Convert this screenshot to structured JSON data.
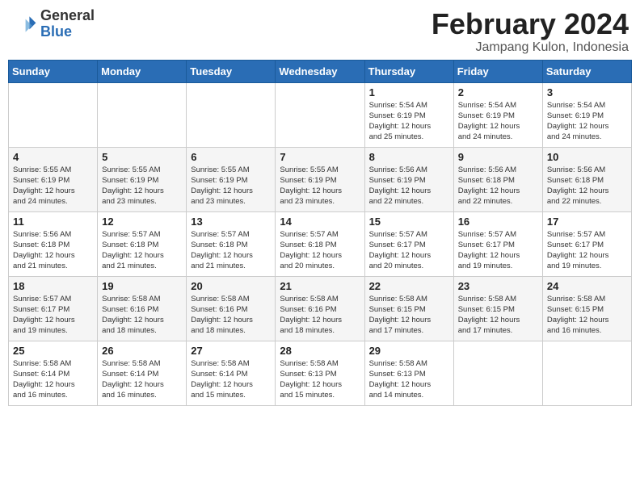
{
  "header": {
    "logo_general": "General",
    "logo_blue": "Blue",
    "month_year": "February 2024",
    "location": "Jampang Kulon, Indonesia"
  },
  "calendar": {
    "days_of_week": [
      "Sunday",
      "Monday",
      "Tuesday",
      "Wednesday",
      "Thursday",
      "Friday",
      "Saturday"
    ],
    "weeks": [
      [
        {
          "day": "",
          "info": ""
        },
        {
          "day": "",
          "info": ""
        },
        {
          "day": "",
          "info": ""
        },
        {
          "day": "",
          "info": ""
        },
        {
          "day": "1",
          "info": "Sunrise: 5:54 AM\nSunset: 6:19 PM\nDaylight: 12 hours\nand 25 minutes."
        },
        {
          "day": "2",
          "info": "Sunrise: 5:54 AM\nSunset: 6:19 PM\nDaylight: 12 hours\nand 24 minutes."
        },
        {
          "day": "3",
          "info": "Sunrise: 5:54 AM\nSunset: 6:19 PM\nDaylight: 12 hours\nand 24 minutes."
        }
      ],
      [
        {
          "day": "4",
          "info": "Sunrise: 5:55 AM\nSunset: 6:19 PM\nDaylight: 12 hours\nand 24 minutes."
        },
        {
          "day": "5",
          "info": "Sunrise: 5:55 AM\nSunset: 6:19 PM\nDaylight: 12 hours\nand 23 minutes."
        },
        {
          "day": "6",
          "info": "Sunrise: 5:55 AM\nSunset: 6:19 PM\nDaylight: 12 hours\nand 23 minutes."
        },
        {
          "day": "7",
          "info": "Sunrise: 5:55 AM\nSunset: 6:19 PM\nDaylight: 12 hours\nand 23 minutes."
        },
        {
          "day": "8",
          "info": "Sunrise: 5:56 AM\nSunset: 6:19 PM\nDaylight: 12 hours\nand 22 minutes."
        },
        {
          "day": "9",
          "info": "Sunrise: 5:56 AM\nSunset: 6:18 PM\nDaylight: 12 hours\nand 22 minutes."
        },
        {
          "day": "10",
          "info": "Sunrise: 5:56 AM\nSunset: 6:18 PM\nDaylight: 12 hours\nand 22 minutes."
        }
      ],
      [
        {
          "day": "11",
          "info": "Sunrise: 5:56 AM\nSunset: 6:18 PM\nDaylight: 12 hours\nand 21 minutes."
        },
        {
          "day": "12",
          "info": "Sunrise: 5:57 AM\nSunset: 6:18 PM\nDaylight: 12 hours\nand 21 minutes."
        },
        {
          "day": "13",
          "info": "Sunrise: 5:57 AM\nSunset: 6:18 PM\nDaylight: 12 hours\nand 21 minutes."
        },
        {
          "day": "14",
          "info": "Sunrise: 5:57 AM\nSunset: 6:18 PM\nDaylight: 12 hours\nand 20 minutes."
        },
        {
          "day": "15",
          "info": "Sunrise: 5:57 AM\nSunset: 6:17 PM\nDaylight: 12 hours\nand 20 minutes."
        },
        {
          "day": "16",
          "info": "Sunrise: 5:57 AM\nSunset: 6:17 PM\nDaylight: 12 hours\nand 19 minutes."
        },
        {
          "day": "17",
          "info": "Sunrise: 5:57 AM\nSunset: 6:17 PM\nDaylight: 12 hours\nand 19 minutes."
        }
      ],
      [
        {
          "day": "18",
          "info": "Sunrise: 5:57 AM\nSunset: 6:17 PM\nDaylight: 12 hours\nand 19 minutes."
        },
        {
          "day": "19",
          "info": "Sunrise: 5:58 AM\nSunset: 6:16 PM\nDaylight: 12 hours\nand 18 minutes."
        },
        {
          "day": "20",
          "info": "Sunrise: 5:58 AM\nSunset: 6:16 PM\nDaylight: 12 hours\nand 18 minutes."
        },
        {
          "day": "21",
          "info": "Sunrise: 5:58 AM\nSunset: 6:16 PM\nDaylight: 12 hours\nand 18 minutes."
        },
        {
          "day": "22",
          "info": "Sunrise: 5:58 AM\nSunset: 6:15 PM\nDaylight: 12 hours\nand 17 minutes."
        },
        {
          "day": "23",
          "info": "Sunrise: 5:58 AM\nSunset: 6:15 PM\nDaylight: 12 hours\nand 17 minutes."
        },
        {
          "day": "24",
          "info": "Sunrise: 5:58 AM\nSunset: 6:15 PM\nDaylight: 12 hours\nand 16 minutes."
        }
      ],
      [
        {
          "day": "25",
          "info": "Sunrise: 5:58 AM\nSunset: 6:14 PM\nDaylight: 12 hours\nand 16 minutes."
        },
        {
          "day": "26",
          "info": "Sunrise: 5:58 AM\nSunset: 6:14 PM\nDaylight: 12 hours\nand 16 minutes."
        },
        {
          "day": "27",
          "info": "Sunrise: 5:58 AM\nSunset: 6:14 PM\nDaylight: 12 hours\nand 15 minutes."
        },
        {
          "day": "28",
          "info": "Sunrise: 5:58 AM\nSunset: 6:13 PM\nDaylight: 12 hours\nand 15 minutes."
        },
        {
          "day": "29",
          "info": "Sunrise: 5:58 AM\nSunset: 6:13 PM\nDaylight: 12 hours\nand 14 minutes."
        },
        {
          "day": "",
          "info": ""
        },
        {
          "day": "",
          "info": ""
        }
      ]
    ]
  }
}
